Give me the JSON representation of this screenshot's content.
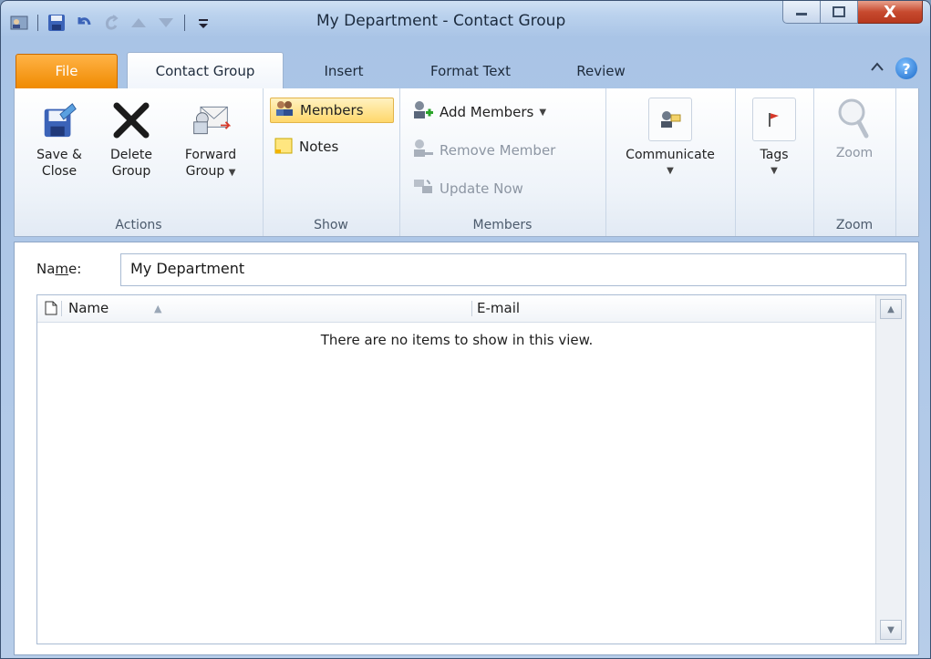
{
  "window": {
    "title": "My Department - Contact Group"
  },
  "qat": {
    "separator_glyph": "|"
  },
  "window_controls": {
    "minimize": "—",
    "maximize": "▢",
    "close": "X"
  },
  "tabs": [
    {
      "label": "File"
    },
    {
      "label": "Contact Group"
    },
    {
      "label": "Insert"
    },
    {
      "label": "Format Text"
    },
    {
      "label": "Review"
    }
  ],
  "ribbon": {
    "actions": {
      "label": "Actions",
      "save_close": [
        "Save &",
        "Close"
      ],
      "delete_group": [
        "Delete",
        "Group"
      ],
      "forward_group": [
        "Forward",
        "Group"
      ]
    },
    "show": {
      "label": "Show",
      "members": "Members",
      "notes": "Notes"
    },
    "members": {
      "label": "Members",
      "add_members": "Add Members",
      "remove_member": "Remove Member",
      "update_now": "Update Now"
    },
    "communicate": {
      "label": "Communicate"
    },
    "tags": {
      "label": "Tags"
    },
    "zoom": {
      "button": "Zoom",
      "label": "Zoom"
    }
  },
  "form": {
    "name_label_pre": "Na",
    "name_label_accel": "m",
    "name_label_post": "e:",
    "name_value": "My Department"
  },
  "list": {
    "columns": [
      "Name",
      "E-mail"
    ],
    "empty_message": "There are no items to show in this view."
  },
  "colors": {
    "file_tab": "#f08a00",
    "close_button": "#c74a2f",
    "selected_button": "#ffd86b"
  }
}
